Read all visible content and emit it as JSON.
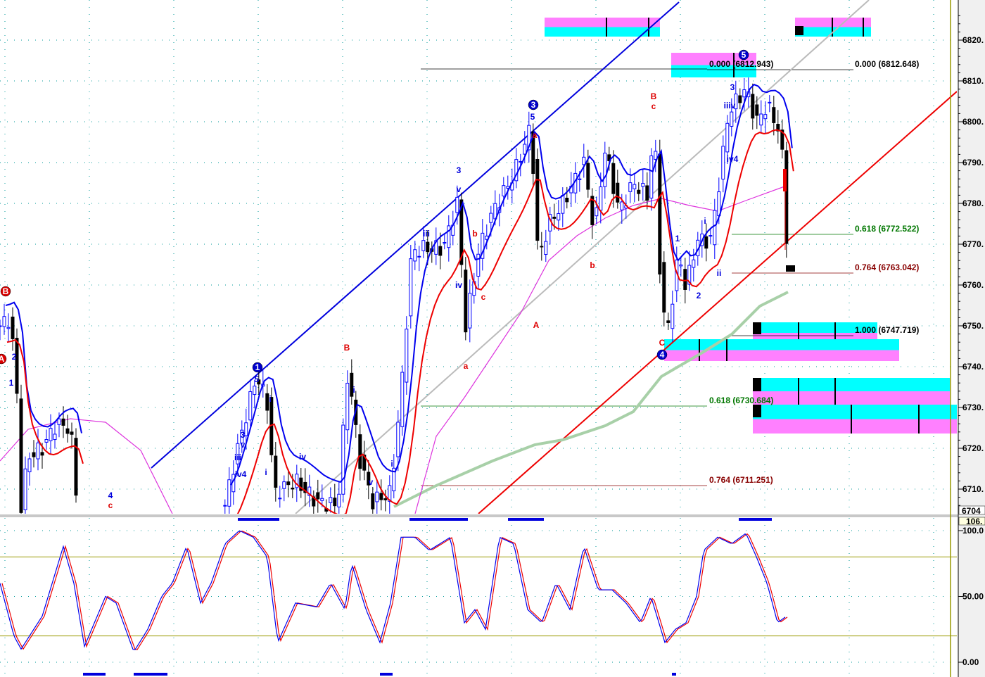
{
  "chart_data": {
    "type": "candlestick",
    "title": "",
    "price_axis": {
      "ylim": [
        6704,
        6826
      ],
      "ticks": [
        "6820.",
        "6810.",
        "6800.",
        "6790.",
        "6780.",
        "6770.",
        "6760.",
        "6750.",
        "6740.",
        "6730.",
        "6720.",
        "6710."
      ],
      "bottom_readout": "6704"
    },
    "oscillator_axis": {
      "ylim": [
        0,
        106
      ],
      "ticks": [
        "100.0",
        "50.00",
        "0.00"
      ],
      "top_readout": "106.",
      "levels": [
        80,
        20
      ]
    },
    "price_segments": [
      [
        [
          0,
          6750
        ],
        [
          2.5,
          6752
        ],
        [
          4,
          6733
        ],
        [
          5,
          6706
        ],
        [
          6.7,
          6718
        ],
        [
          10,
          6720
        ],
        [
          13.3,
          6726
        ],
        [
          16.7,
          6725
        ],
        [
          18.3,
          6706
        ]
      ],
      [
        [
          53.3,
          6706
        ],
        [
          55.8,
          6718
        ],
        [
          60.8,
          6738
        ],
        [
          63.3,
          6731
        ],
        [
          65,
          6709
        ],
        [
          70,
          6712
        ],
        [
          75,
          6707
        ],
        [
          80,
          6706
        ],
        [
          82.5,
          6740
        ],
        [
          85,
          6718
        ],
        [
          88.3,
          6707
        ],
        [
          92.5,
          6709
        ],
        [
          95,
          6733
        ],
        [
          97.5,
          6768
        ],
        [
          100,
          6769
        ],
        [
          105,
          6769
        ],
        [
          108.3,
          6780
        ],
        [
          110.3,
          6750
        ],
        [
          113.3,
          6768
        ],
        [
          116.7,
          6778
        ],
        [
          121.7,
          6787
        ],
        [
          125.8,
          6799
        ],
        [
          127.5,
          6766
        ],
        [
          130,
          6775
        ],
        [
          133.3,
          6780
        ],
        [
          138.3,
          6790
        ],
        [
          140.8,
          6773
        ],
        [
          143.3,
          6793
        ],
        [
          146.7,
          6778
        ],
        [
          150,
          6785
        ],
        [
          153.3,
          6782
        ],
        [
          155,
          6799
        ],
        [
          156.7,
          6754
        ],
        [
          158.3,
          6750
        ],
        [
          160.8,
          6768
        ],
        [
          162.5,
          6759
        ],
        [
          165,
          6771
        ],
        [
          168.3,
          6771
        ],
        [
          170.8,
          6788
        ],
        [
          172.5,
          6802
        ],
        [
          175,
          6806
        ],
        [
          176.7,
          6808
        ],
        [
          179.2,
          6800
        ],
        [
          181.7,
          6804
        ],
        [
          184.2,
          6799
        ],
        [
          185.8,
          6788
        ],
        [
          186.3,
          6772
        ]
      ]
    ],
    "oscillator": [
      [
        0,
        60
      ],
      [
        3.3,
        20
      ],
      [
        5,
        10
      ],
      [
        10,
        35
      ],
      [
        15,
        88
      ],
      [
        17.5,
        60
      ],
      [
        20,
        12
      ],
      [
        25,
        50
      ],
      [
        27.5,
        45
      ],
      [
        31.7,
        8
      ],
      [
        35,
        25
      ],
      [
        38.3,
        50
      ],
      [
        40.8,
        60
      ],
      [
        44.2,
        88
      ],
      [
        47.5,
        45
      ],
      [
        50,
        60
      ],
      [
        53.3,
        90
      ],
      [
        56.7,
        100
      ],
      [
        60,
        95
      ],
      [
        63.3,
        80
      ],
      [
        65.8,
        15
      ],
      [
        70,
        45
      ],
      [
        75,
        42
      ],
      [
        78.3,
        60
      ],
      [
        81.7,
        40
      ],
      [
        83.3,
        75
      ],
      [
        86.7,
        40
      ],
      [
        90,
        15
      ],
      [
        92.5,
        45
      ],
      [
        95,
        95
      ],
      [
        98.3,
        95
      ],
      [
        101.7,
        85
      ],
      [
        106.7,
        95
      ],
      [
        110,
        30
      ],
      [
        112.5,
        40
      ],
      [
        115,
        25
      ],
      [
        118.3,
        95
      ],
      [
        121.7,
        90
      ],
      [
        125,
        40
      ],
      [
        128.3,
        30
      ],
      [
        131.7,
        60
      ],
      [
        135,
        40
      ],
      [
        138.3,
        88
      ],
      [
        141.7,
        55
      ],
      [
        145,
        55
      ],
      [
        148.3,
        45
      ],
      [
        151.7,
        30
      ],
      [
        154.2,
        50
      ],
      [
        157.5,
        15
      ],
      [
        160,
        25
      ],
      [
        162.5,
        30
      ],
      [
        165,
        50
      ],
      [
        166.7,
        85
      ],
      [
        170,
        95
      ],
      [
        173.3,
        90
      ],
      [
        176.7,
        98
      ],
      [
        179.2,
        80
      ],
      [
        181.7,
        60
      ],
      [
        184.2,
        30
      ],
      [
        186.3,
        35
      ]
    ],
    "fib_levels": [
      {
        "label": "0.000 (6812.943)",
        "price": 6812.943,
        "color": "#000000"
      },
      {
        "label": "0.000 (6812.648)",
        "price": 6812.648,
        "color": "#000000"
      },
      {
        "label": "0.618 (6772.522)",
        "price": 6772.522,
        "color": "#007700"
      },
      {
        "label": "0.764 (6763.042)",
        "price": 6763.042,
        "color": "#880000"
      },
      {
        "label": "1.000 (6747.719)",
        "price": 6747.719,
        "color": "#000000"
      },
      {
        "label": "0.618 (6730.684)",
        "price": 6730.684,
        "color": "#007700"
      },
      {
        "label": "0.764 (6711.251)",
        "price": 6711.251,
        "color": "#880000"
      }
    ],
    "wave_circles": [
      {
        "text": "B",
        "color": "#dd0000"
      },
      {
        "text": "A",
        "color": "#dd0000"
      },
      {
        "text": "1",
        "color": "#0000cc"
      },
      {
        "text": "3",
        "color": "#0000cc"
      },
      {
        "text": "5",
        "color": "#0000cc"
      },
      {
        "text": "4",
        "color": "#0000cc"
      }
    ],
    "wave_labels": [
      {
        "text": "2",
        "color": "#0000dd"
      },
      {
        "text": "1",
        "color": "#0000dd"
      },
      {
        "text": "4",
        "color": "#0000dd"
      },
      {
        "text": "c",
        "color": "#dd0000"
      },
      {
        "text": "5",
        "color": "#0000dd"
      },
      {
        "text": "3",
        "color": "#0000dd"
      },
      {
        "text": "v",
        "color": "#0000dd"
      },
      {
        "text": "iii",
        "color": "#0000dd"
      },
      {
        "text": "iv4",
        "color": "#0000dd"
      },
      {
        "text": "i",
        "color": "#0000dd"
      },
      {
        "text": "i",
        "color": "#0000dd"
      },
      {
        "text": "iv",
        "color": "#0000dd"
      },
      {
        "text": "B",
        "color": "#dd0000"
      },
      {
        "text": "i",
        "color": "#0000dd"
      },
      {
        "text": "v",
        "color": "#0000dd"
      },
      {
        "text": "i",
        "color": "#0000dd"
      },
      {
        "text": "iii",
        "color": "#0000dd"
      },
      {
        "text": "iv",
        "color": "#0000dd"
      },
      {
        "text": "3",
        "color": "#0000dd"
      },
      {
        "text": "v",
        "color": "#0000dd"
      },
      {
        "text": "b",
        "color": "#dd0000"
      },
      {
        "text": "c",
        "color": "#dd0000"
      },
      {
        "text": "a",
        "color": "#dd0000"
      },
      {
        "text": "5",
        "color": "#0000dd"
      },
      {
        "text": "a",
        "color": "#dd0000"
      },
      {
        "text": "A",
        "color": "#dd0000"
      },
      {
        "text": "b",
        "color": "#dd0000"
      },
      {
        "text": "B",
        "color": "#dd0000"
      },
      {
        "text": "c",
        "color": "#dd0000"
      },
      {
        "text": "C",
        "color": "#dd0000"
      },
      {
        "text": "i",
        "color": "#0000dd"
      },
      {
        "text": "ii",
        "color": "#0000dd"
      },
      {
        "text": "2",
        "color": "#0000dd"
      },
      {
        "text": "1",
        "color": "#0000dd"
      },
      {
        "text": "3",
        "color": "#0000dd"
      },
      {
        "text": "iiiv",
        "color": "#0000dd"
      },
      {
        "text": "iv4",
        "color": "#0000dd"
      }
    ],
    "colors": {
      "up": "#0000ff",
      "down": "#000000",
      "band_upper": "#0000ee",
      "band_lower": "#ee0000",
      "ma_slow": "#dd33dd",
      "ma_long": "#a8d0a8",
      "zone_pink": "#ff80ff",
      "zone_cyan": "#00ffff",
      "axis_bg": "#f0f0f0",
      "level_line": "#999900"
    }
  }
}
